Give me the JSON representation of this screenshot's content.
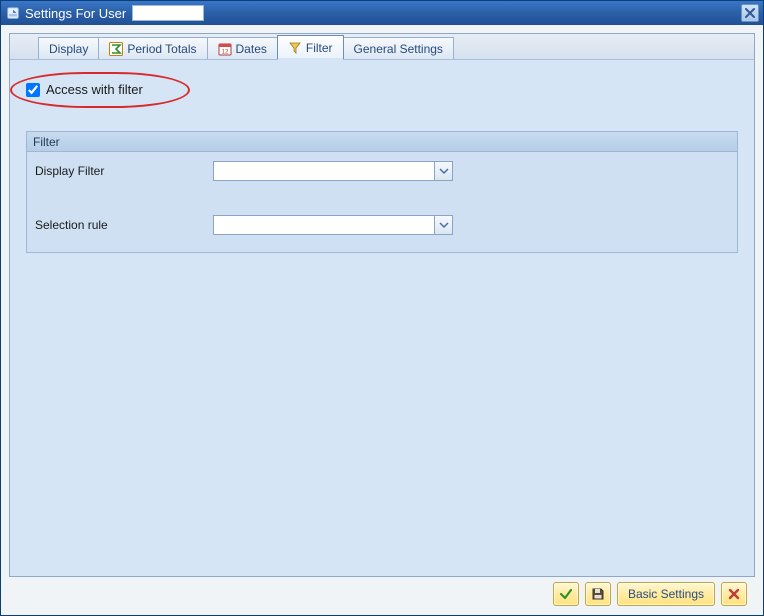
{
  "titlebar": {
    "title": "Settings For User",
    "user_value": ""
  },
  "tabs": {
    "display": {
      "label": "Display"
    },
    "totals": {
      "label": "Period Totals"
    },
    "dates": {
      "label": "Dates"
    },
    "filter": {
      "label": "Filter"
    },
    "general": {
      "label": "General Settings"
    }
  },
  "panel": {
    "access_with_filter_label": "Access with filter",
    "access_with_filter_checked": true,
    "group_title": "Filter",
    "display_filter_label": "Display Filter",
    "display_filter_value": "",
    "selection_rule_label": "Selection rule",
    "selection_rule_value": ""
  },
  "buttons": {
    "basic_settings_label": "Basic Settings"
  }
}
